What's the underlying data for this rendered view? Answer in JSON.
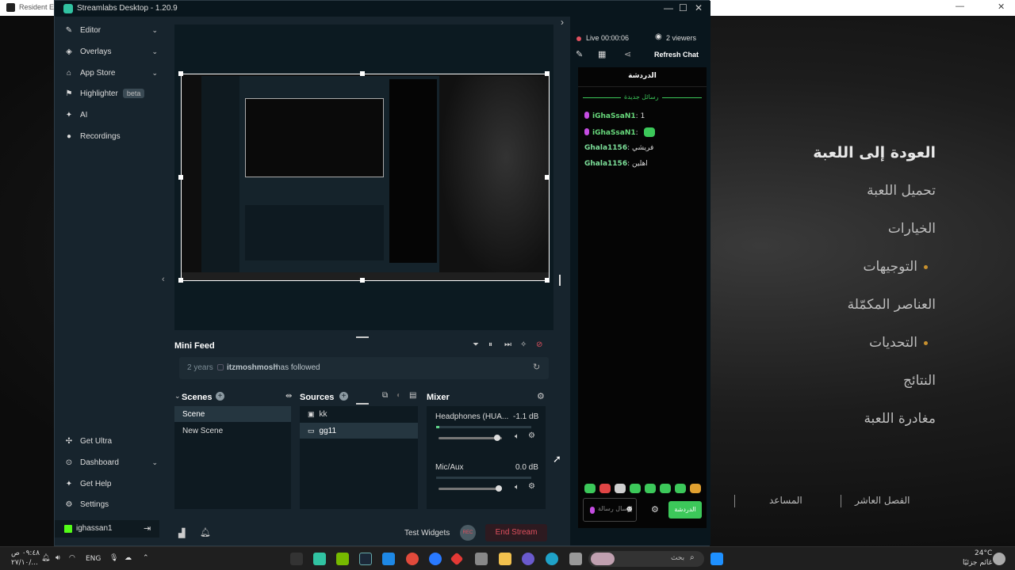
{
  "game": {
    "window_title": "Resident Evil",
    "menu": [
      "العودة إلى اللعبة",
      "تحميل اللعبة",
      "الخيارات",
      "التوجيهات",
      "العناصر المكمّلة",
      "التحديات",
      "النتائج",
      "مغادرة اللعبة"
    ],
    "footer_left": "المساعد",
    "footer_right": "الفصل العاشر"
  },
  "app": {
    "title": "Streamlabs Desktop - 1.20.9",
    "collapse_arrow": "›"
  },
  "sidebar": {
    "top_items": [
      {
        "icon": "✎",
        "label": "Editor",
        "chevron": "⌄"
      },
      {
        "icon": "◈",
        "label": "Overlays",
        "chevron": "⌄"
      },
      {
        "icon": "⌂",
        "label": "App Store",
        "chevron": "⌄"
      },
      {
        "icon": "⚑",
        "label": "Highlighter",
        "badge": "beta"
      },
      {
        "icon": "✦",
        "label": "AI"
      },
      {
        "icon": "●",
        "label": "Recordings"
      }
    ],
    "bottom_items": [
      {
        "icon": "✣",
        "label": "Get Ultra"
      },
      {
        "icon": "⊙",
        "label": "Dashboard",
        "chevron": "⌄"
      },
      {
        "icon": "✦",
        "label": "Get Help"
      },
      {
        "icon": "⚙",
        "label": "Settings"
      }
    ],
    "user": {
      "name": "ighassan1",
      "logout_icon": "⇥"
    }
  },
  "minifeed": {
    "title": "Mini Feed",
    "time": "2 years",
    "user": "itzmoshmosh",
    "action": "has followed"
  },
  "scenes": {
    "title": "Scenes",
    "items": [
      "Scene",
      "New Scene"
    ]
  },
  "sources": {
    "title": "Sources",
    "items": [
      "kk",
      "gg11"
    ]
  },
  "mixer": {
    "title": "Mixer",
    "channels": [
      {
        "name": "Headphones (HUA...",
        "db": "-1.1 dB",
        "level": 0.92
      },
      {
        "name": "Mic/Aux",
        "db": "0.0 dB",
        "level": 0.95
      }
    ]
  },
  "footer": {
    "test_widgets": "Test Widgets",
    "rec": "REC",
    "end_stream": "End Stream"
  },
  "chat": {
    "live_status": "Live 00:00:06",
    "viewers": "2 viewers",
    "refresh": "Refresh Chat",
    "title": "الدردشة",
    "divider": "رسائل جديدة",
    "messages": [
      {
        "user": "iGhaSsaN1",
        "sep": ":",
        "text": "1"
      },
      {
        "user": "iGhaSsaN1",
        "sep": ":",
        "text": ""
      },
      {
        "user": "Ghala1156",
        "sep": ":",
        "text": "فريشي"
      },
      {
        "user": "Ghala1156",
        "sep": ":",
        "text": "اهلين"
      }
    ],
    "input_placeholder": "إرسال رسالة",
    "send_button": "الدردشة"
  },
  "taskbar": {
    "clock_time": "٠٩:٤٨ ص",
    "clock_date": "٢٧/١٠/...",
    "lang": "ENG",
    "search_placeholder": "بحث",
    "weather_temp": "24°C",
    "weather_desc": "غائم جزئيًا"
  }
}
